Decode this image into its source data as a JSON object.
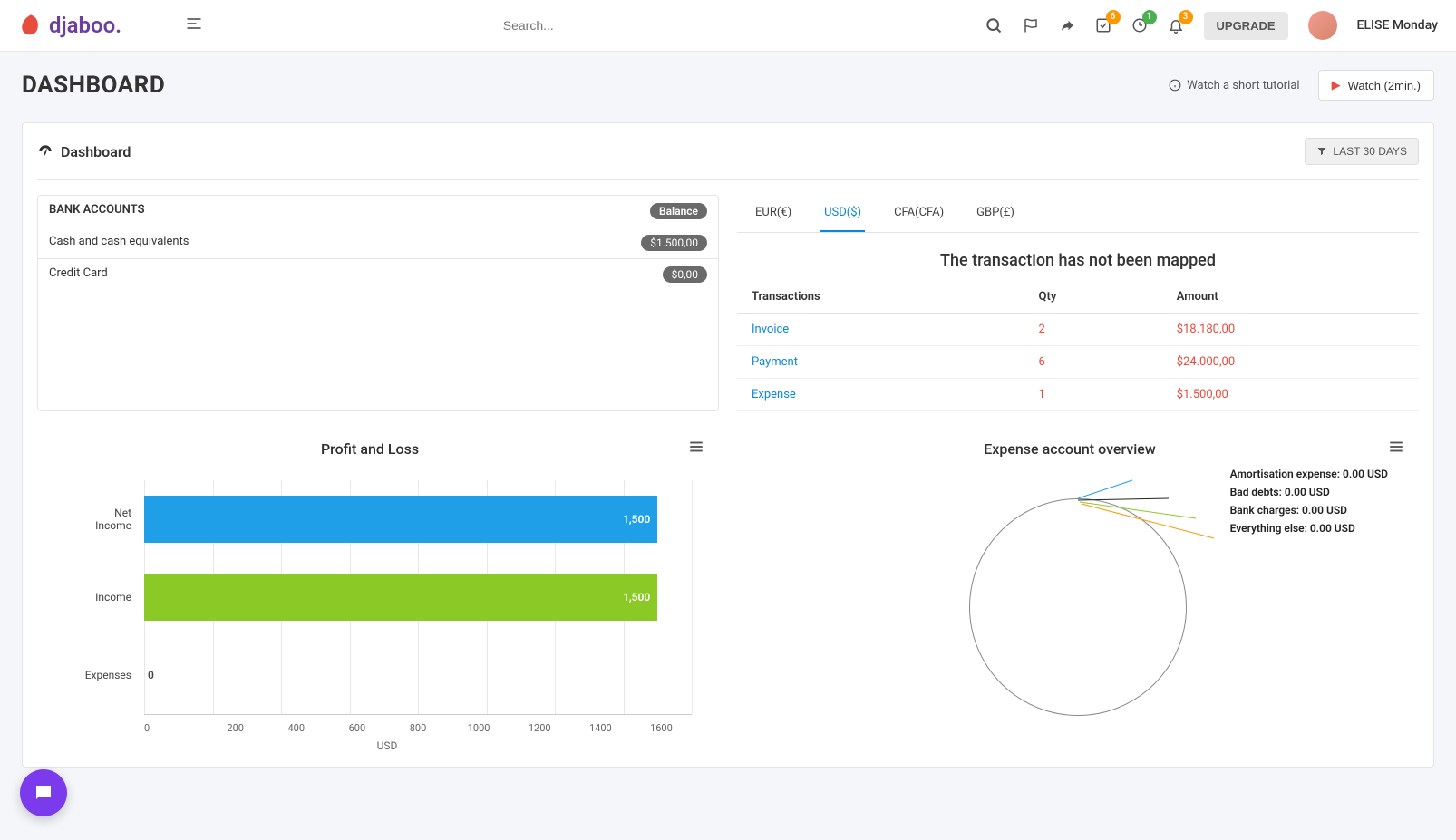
{
  "header": {
    "logo_text": "djaboo.",
    "search_placeholder": "Search...",
    "badge_check": "6",
    "badge_target": "1",
    "badge_bell": "3",
    "upgrade_label": "UPGRADE",
    "username": "ELISE Monday"
  },
  "page": {
    "title": "DASHBOARD",
    "tutorial_text": "Watch a short tutorial",
    "watch_btn": "Watch (2min.)"
  },
  "dashboard": {
    "title": "Dashboard",
    "filter_label": "LAST 30 DAYS"
  },
  "bank_accounts": {
    "header_left": "BANK ACCOUNTS",
    "header_right": "Balance",
    "rows": [
      {
        "name": "Cash and cash equivalents",
        "balance": "$1.500,00"
      },
      {
        "name": "Credit Card",
        "balance": "$0,00"
      }
    ]
  },
  "currency_tabs": [
    "EUR(€)",
    "USD($)",
    "CFA(CFA)",
    "GBP(£)"
  ],
  "currency_active": 1,
  "transactions": {
    "not_mapped_title": "The transaction has not been mapped",
    "col_trans": "Transactions",
    "col_qty": "Qty",
    "col_amount": "Amount",
    "rows": [
      {
        "name": "Invoice",
        "qty": "2",
        "amount": "$18.180,00"
      },
      {
        "name": "Payment",
        "qty": "6",
        "amount": "$24.000,00"
      },
      {
        "name": "Expense",
        "qty": "1",
        "amount": "$1.500,00"
      }
    ]
  },
  "chart_data": [
    {
      "type": "bar",
      "title": "Profit and Loss",
      "xlabel": "USD",
      "categories": [
        "Net Income",
        "Income",
        "Expenses"
      ],
      "values": [
        1500,
        1500,
        0
      ],
      "value_labels": [
        "1,500",
        "1,500",
        "0"
      ],
      "colors": [
        "#1e9fe8",
        "#8ac926",
        "#1e9fe8"
      ],
      "xlim": [
        0,
        1600
      ],
      "xticks": [
        0,
        200,
        400,
        600,
        800,
        1000,
        1200,
        1400,
        1600
      ]
    },
    {
      "type": "pie",
      "title": "Expense account overview",
      "series": [
        {
          "name": "Amortisation expense",
          "value": 0,
          "unit": "USD",
          "color": "#1e9fe8"
        },
        {
          "name": "Bad debts",
          "value": 0,
          "unit": "USD",
          "color": "#222"
        },
        {
          "name": "Bank charges",
          "value": 0,
          "unit": "USD",
          "color": "#8ac926"
        },
        {
          "name": "Everything else",
          "value": 0,
          "unit": "USD",
          "color": "#ff9800"
        }
      ],
      "labels": [
        "Amortisation expense: 0.00 USD",
        "Bad debts: 0.00 USD",
        "Bank charges: 0.00 USD",
        "Everything else: 0.00 USD"
      ]
    }
  ]
}
